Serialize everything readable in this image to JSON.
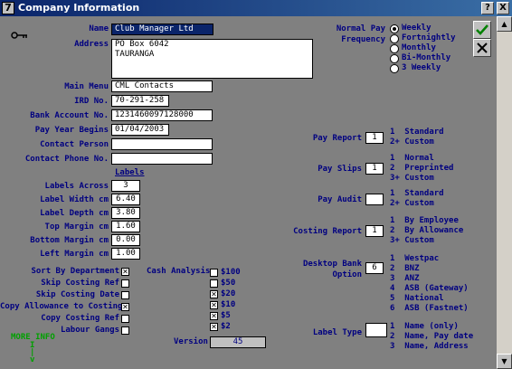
{
  "window": {
    "title": "Company Information",
    "icon_label": "7",
    "help_label": "?",
    "close_label": "X",
    "ok_icon": "check-icon",
    "cancel_icon": "x-icon"
  },
  "company": {
    "name_label": "Name",
    "name_value": "Club Manager Ltd",
    "address_label": "Address",
    "address_line1": "PO Box 6042",
    "address_line2": "TAURANGA",
    "main_menu_label": "Main Menu",
    "main_menu_value": "CML Contacts",
    "ird_label": "IRD No.",
    "ird_value": "70-291-258",
    "bank_label": "Bank Account No.",
    "bank_value": "1231460097128000",
    "pay_year_label": "Pay Year Begins",
    "pay_year_value": "01/04/2003",
    "contact_label": "Contact Person",
    "contact_value": "",
    "contact_phone_label": "Contact Phone No.",
    "contact_phone_value": ""
  },
  "labels": {
    "heading": "Labels",
    "across_label": "Labels Across",
    "across_value": "3",
    "width_label": "Label Width cm",
    "width_value": "6.40",
    "depth_label": "Label Depth cm",
    "depth_value": "3.80",
    "top_label": "Top Margin cm",
    "top_value": "1.60",
    "bottom_label": "Bottom Margin cm",
    "bottom_value": "0.00",
    "left_label": "Left Margin cm",
    "left_value": "1.00"
  },
  "options": {
    "sort_by_department": {
      "label": "Sort By Department",
      "checked": true
    },
    "skip_costing_ref": {
      "label": "Skip Costing Ref",
      "checked": false
    },
    "skip_costing_date": {
      "label": "Skip Costing Date",
      "checked": false
    },
    "copy_allowance": {
      "label": "Copy Allowance to Costing",
      "checked": true
    },
    "copy_costing_ref": {
      "label": "Copy Costing Ref",
      "checked": false
    },
    "labour_gangs": {
      "label": "Labour Gangs",
      "checked": false
    }
  },
  "cash_analysis": {
    "label": "Cash Analysis",
    "items": [
      {
        "label": "$100",
        "checked": false
      },
      {
        "label": "$50",
        "checked": false
      },
      {
        "label": "$20",
        "checked": true
      },
      {
        "label": "$10",
        "checked": true
      },
      {
        "label": "$5",
        "checked": true
      },
      {
        "label": "$2",
        "checked": true
      }
    ]
  },
  "version": {
    "label": "Version",
    "value": "45"
  },
  "more_info": {
    "label": "MORE INFO",
    "arrow": "I\n|\nv"
  },
  "pay_frequency": {
    "label_line1": "Normal Pay",
    "label_line2": "Frequency",
    "options": [
      "Weekly",
      "Fortnightly",
      "Monthly",
      "Bi-Monthly",
      "3 Weekly"
    ],
    "selected": 0
  },
  "pay_report": {
    "label": "Pay Report",
    "value": "1",
    "legend": [
      "1  Standard",
      "2+ Custom"
    ]
  },
  "pay_slips": {
    "label": "Pay Slips",
    "value": "1",
    "legend": [
      "1  Normal",
      "2  Preprinted",
      "3+ Custom"
    ]
  },
  "pay_audit": {
    "label": "Pay Audit",
    "value": "",
    "legend": [
      "1  Standard",
      "2+ Custom"
    ]
  },
  "costing_report": {
    "label": "Costing Report",
    "value": "1",
    "legend": [
      "1  By Employee",
      "2  By Allowance",
      "3+ Custom"
    ]
  },
  "desktop_bank": {
    "label_line1": "Desktop Bank",
    "label_line2": "Option",
    "value": "6",
    "legend": [
      "1  Westpac",
      "2  BNZ",
      "3  ANZ",
      "4  ASB (Gateway)",
      "5  National",
      "6  ASB (Fastnet)"
    ]
  },
  "label_type": {
    "label": "Label Type",
    "value": "",
    "legend": [
      "1  Name (only)",
      "2  Name, Pay date",
      "3  Name, Address"
    ]
  },
  "colors": {
    "window_bg": "#808080",
    "label": "#000080",
    "title_bar": "#0a246a"
  }
}
